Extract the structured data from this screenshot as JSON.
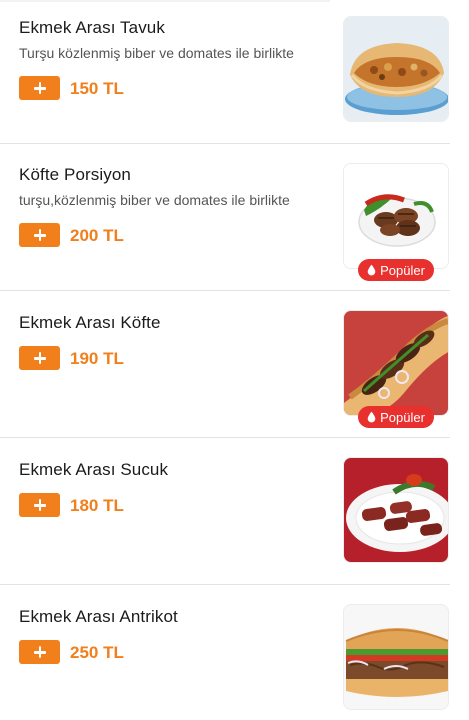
{
  "currency_suffix": "TL",
  "popular_badge": "Popüler",
  "accent_color": "#f07f1c",
  "badge_color": "#e8302f",
  "items": [
    {
      "title": "Ekmek Arası Tavuk",
      "description": "Turşu közlenmiş biber ve domates ile birlikte",
      "price": "150 TL",
      "popular": false,
      "image": "chicken-sandwich-image"
    },
    {
      "title": "Köfte Porsiyon",
      "description": "turşu,közlenmiş biber ve domates ile birlikte",
      "price": "200 TL",
      "popular": true,
      "image": "kofte-plate-image"
    },
    {
      "title": "Ekmek Arası Köfte",
      "description": "",
      "price": "190 TL",
      "popular": true,
      "image": "kofte-sandwich-image"
    },
    {
      "title": "Ekmek Arası Sucuk",
      "description": "",
      "price": "180 TL",
      "popular": false,
      "image": "sucuk-plate-image"
    },
    {
      "title": "Ekmek Arası Antrikot",
      "description": "",
      "price": "250 TL",
      "popular": false,
      "image": "antrikot-sandwich-image"
    }
  ]
}
